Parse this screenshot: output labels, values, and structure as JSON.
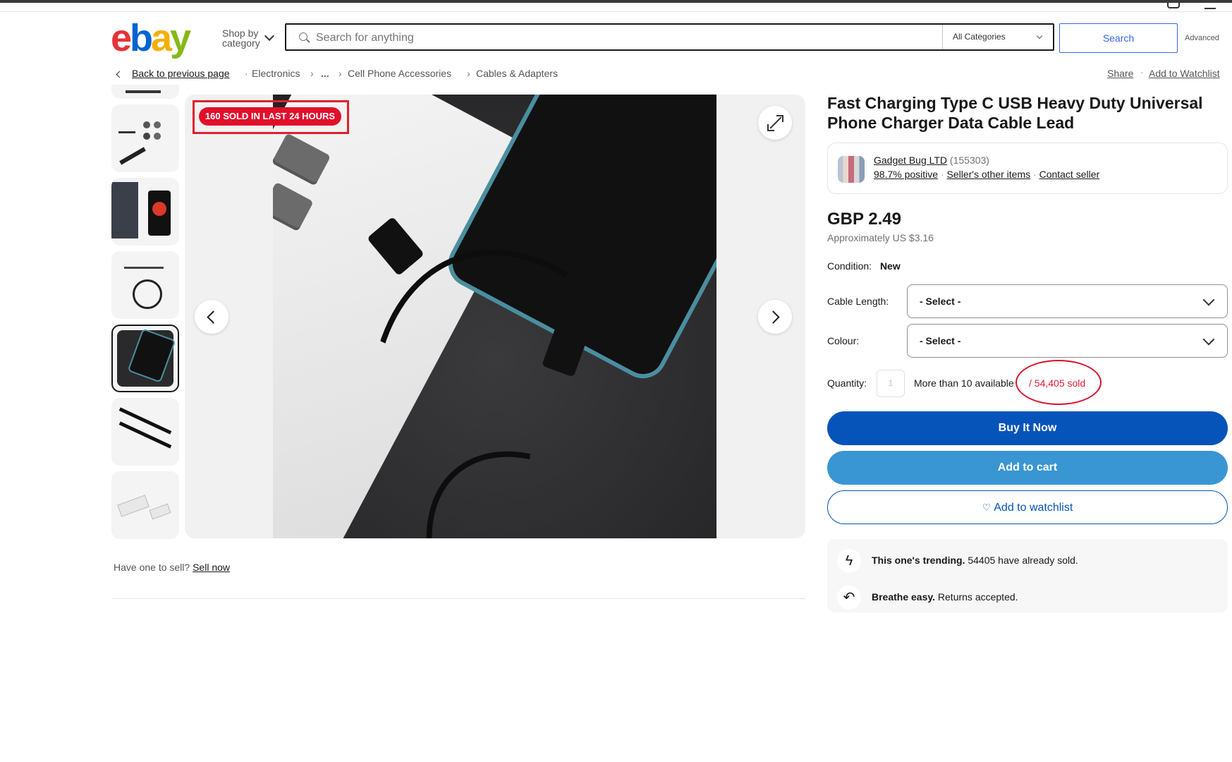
{
  "search": {
    "shop_by_category": "Shop by category",
    "placeholder": "Search for anything",
    "category": "All Categories",
    "button": "Search",
    "advanced": "Advanced"
  },
  "breadcrumb": {
    "back": "Back to previous page",
    "items": [
      "Electronics",
      "...",
      "Cell Phone Accessories",
      "Cables & Adapters"
    ],
    "share": "Share",
    "add_to_watchlist": "Add to Watchlist"
  },
  "gallery": {
    "badge": "160 SOLD IN LAST 24 HOURS",
    "selected_thumbnail": 5,
    "thumbnail_count": 7
  },
  "sell": {
    "text": "Have one to sell?",
    "link": "Sell now"
  },
  "item": {
    "title": "Fast Charging Type C USB Heavy Duty Universal Phone Charger Data Cable Lead",
    "seller_name": "Gadget Bug LTD",
    "seller_feedback": "(155303)",
    "positive": "98.7% positive",
    "other_items": "Seller's other items",
    "contact": "Contact seller",
    "price": "GBP 2.49",
    "approx": "Approximately US $3.16",
    "condition_label": "Condition:",
    "condition_value": "New",
    "cable_length_label": "Cable Length:",
    "cable_length_value": "- Select -",
    "colour_label": "Colour:",
    "colour_value": "- Select -",
    "quantity_label": "Quantity:",
    "quantity_value": "1",
    "available": "More than 10 available",
    "sold": "/ 54,405 sold",
    "buy_now": "Buy It Now",
    "add_to_cart": "Add to cart",
    "add_to_watchlist": "Add to watchlist",
    "trending_bold": "This one's trending.",
    "trending_rest": "54405 have already sold.",
    "returns_bold": "Breathe easy.",
    "returns_rest": "Returns accepted."
  },
  "colors": {
    "buy_now": "#0654ba",
    "add_to_cart": "#3996d3",
    "sold_red": "#dd1e31",
    "badge_red": "#e0102a"
  },
  "icons": {
    "expand": "expand-icon",
    "prev": "chevron-left-icon",
    "next": "chevron-right-icon",
    "trending": "lightning-icon",
    "returns": "return-arrow-icon",
    "watch": "heart-icon"
  }
}
